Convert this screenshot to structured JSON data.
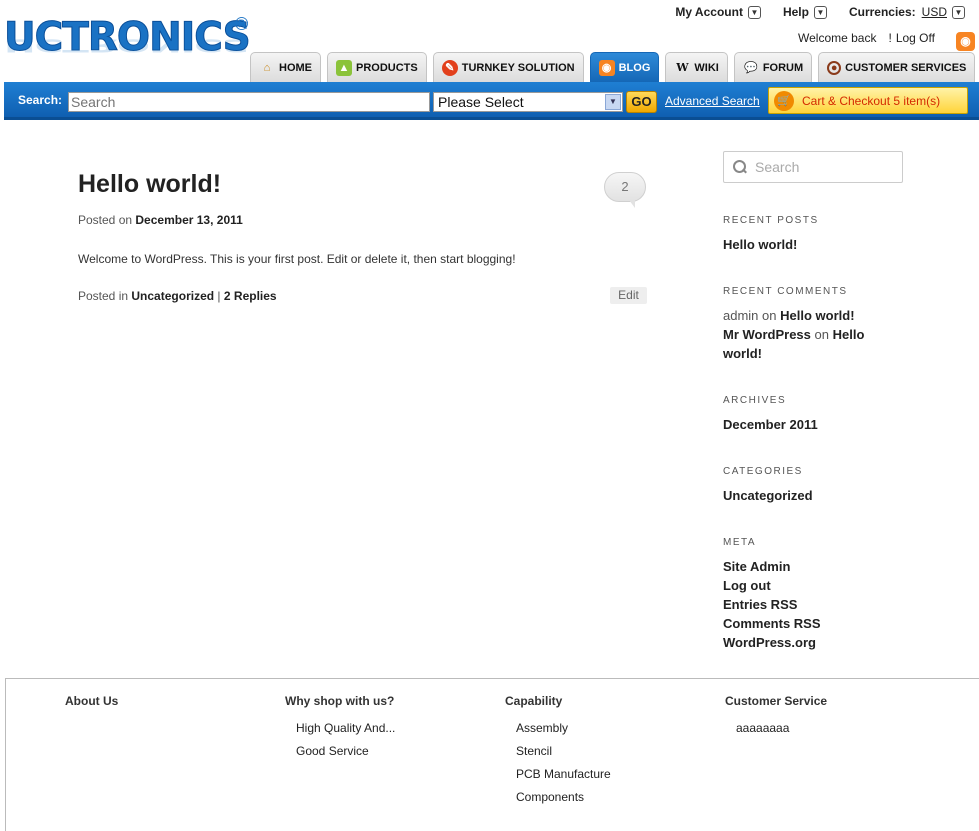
{
  "header": {
    "logo_text": "UCTRONICS",
    "logo_mark": "®",
    "account": {
      "my_account": "My Account",
      "help": "Help",
      "currencies_label": "Currencies:",
      "currency": "USD"
    },
    "welcome": "Welcome back",
    "separator": "!",
    "logoff": "Log Off",
    "tabs": [
      {
        "label": "HOME",
        "icon": "home-icon"
      },
      {
        "label": "PRODUCTS",
        "icon": "android-icon"
      },
      {
        "label": "TURNKEY SOLUTION",
        "icon": "wrench-icon"
      },
      {
        "label": "BLOG",
        "icon": "rss-icon"
      },
      {
        "label": "WIKI",
        "icon": "wikipedia-icon"
      },
      {
        "label": "FORUM",
        "icon": "speech-bubble-icon"
      },
      {
        "label": "CUSTOMER SERVICES",
        "icon": "headset-icon"
      }
    ]
  },
  "search": {
    "label": "Search:",
    "placeholder": "Search",
    "category": "Please Select",
    "go": "GO",
    "advanced": "Advanced Search",
    "cart": "Cart & Checkout",
    "cart_count": "5 item(s)"
  },
  "post": {
    "title": "Hello world!",
    "comment_count": "2",
    "posted_on_label": "Posted on",
    "date": "December 13, 2011",
    "body": "Welcome to WordPress. This is your first post. Edit or delete it, then start blogging!",
    "posted_in_label": "Posted in",
    "category": "Uncategorized",
    "divider": "|",
    "replies": "2 Replies",
    "edit": "Edit"
  },
  "sidebar": {
    "search_placeholder": "Search",
    "recent_posts_title": "RECENT POSTS",
    "recent_posts": [
      "Hello world!"
    ],
    "recent_comments_title": "RECENT COMMENTS",
    "recent_comments": [
      {
        "author": "admin",
        "on": "on",
        "post": "Hello world!"
      },
      {
        "author": "Mr WordPress",
        "on": "on",
        "post_part1": "Hello",
        "post_part2": "world!"
      }
    ],
    "archives_title": "ARCHIVES",
    "archives": [
      "December 2011"
    ],
    "categories_title": "CATEGORIES",
    "categories": [
      "Uncategorized"
    ],
    "meta_title": "META",
    "meta": [
      "Site Admin",
      "Log out",
      "Entries RSS",
      "Comments RSS",
      "WordPress.org"
    ]
  },
  "footer": {
    "columns": [
      {
        "title": "About Us",
        "items": []
      },
      {
        "title": "Why shop with us?",
        "items": [
          "High Quality And...",
          "Good Service"
        ]
      },
      {
        "title": "Capability",
        "items": [
          "Assembly",
          "Stencil",
          "PCB Manufacture",
          "Components"
        ]
      },
      {
        "title": "Customer Service",
        "items": [
          "aaaaaaaa"
        ]
      }
    ]
  },
  "colors": {
    "brand_blue": "#1a72c4",
    "bar_blue": "#1567b6",
    "cart_yellow": "#ffd43b",
    "rss_orange": "#f78422"
  }
}
